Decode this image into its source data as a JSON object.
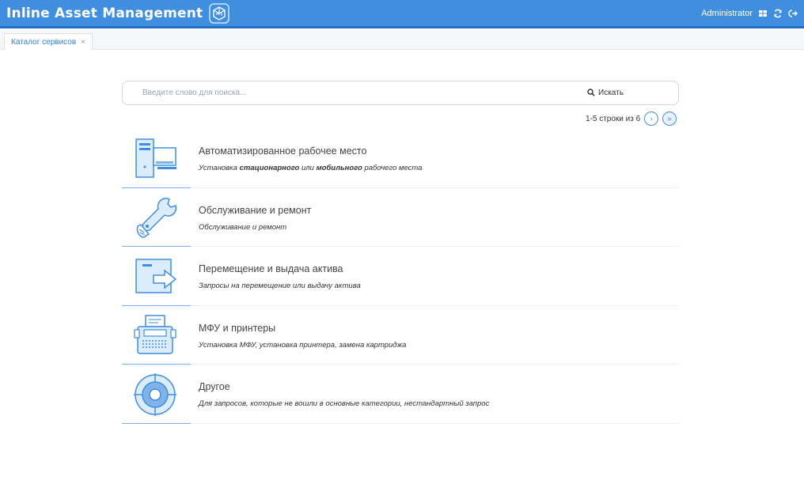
{
  "header": {
    "title": "Inline Asset Management",
    "user": "Administrator",
    "brand_color": "#3f8fde",
    "icons": [
      "grid-icon",
      "refresh-icon",
      "logout-icon"
    ]
  },
  "tabs": [
    {
      "label": "Каталог сервисов",
      "close": "×"
    }
  ],
  "search": {
    "placeholder": "Введите слово для поиска...",
    "button_label": "Искать"
  },
  "pager": {
    "range": "1-5 строки из  6",
    "next": "›",
    "last": "»"
  },
  "services": [
    {
      "title": "Автоматизированное рабочее место",
      "desc_parts": [
        "Установка ",
        "стационарного",
        " или ",
        "мобильного",
        " рабочего места"
      ],
      "icon": "workstation-icon"
    },
    {
      "title": "Обслуживание и ремонт",
      "desc": "Обслуживание и ремонт",
      "icon": "wrench-icon"
    },
    {
      "title": "Перемещение и выдача актива",
      "desc": "Запросы на перемещение или выдачу актива",
      "icon": "transfer-icon"
    },
    {
      "title": "МФУ и принтеры",
      "desc": "Установка МФУ, установка принтера, замена картриджа",
      "icon": "printer-icon"
    },
    {
      "title": "Другое",
      "desc": "Для запросов, которые не вошли в основные категории, нестандартный запрос",
      "icon": "target-icon"
    }
  ]
}
